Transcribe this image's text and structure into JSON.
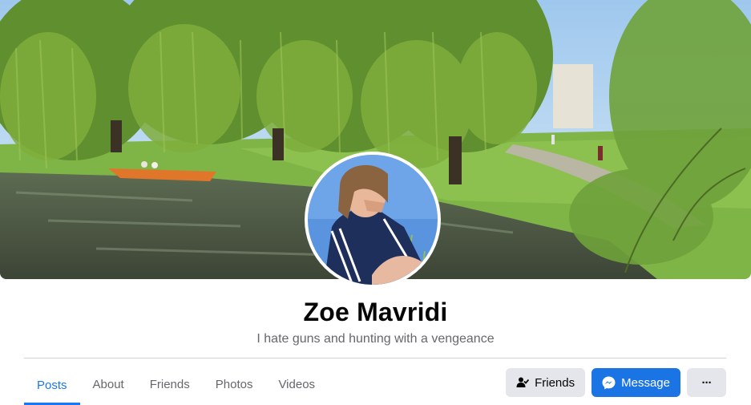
{
  "profile": {
    "name": "Zoe Mavridi",
    "bio": "I hate guns and hunting with a vengeance"
  },
  "cover_photo": {
    "description_icon": "cover-photo-river-willows"
  },
  "avatar": {
    "icon": "profile-picture"
  },
  "tabs": [
    {
      "label": "Posts",
      "active": true
    },
    {
      "label": "About",
      "active": false
    },
    {
      "label": "Friends",
      "active": false
    },
    {
      "label": "Photos",
      "active": false
    },
    {
      "label": "Videos",
      "active": false
    }
  ],
  "actions": {
    "friends_label": "Friends",
    "message_label": "Message",
    "more_label": "···"
  },
  "colors": {
    "accent": "#1877f2",
    "message_button": "#1b74e4",
    "grey_button": "#e4e6eb",
    "text_primary": "#050505",
    "text_secondary": "#65676b"
  }
}
